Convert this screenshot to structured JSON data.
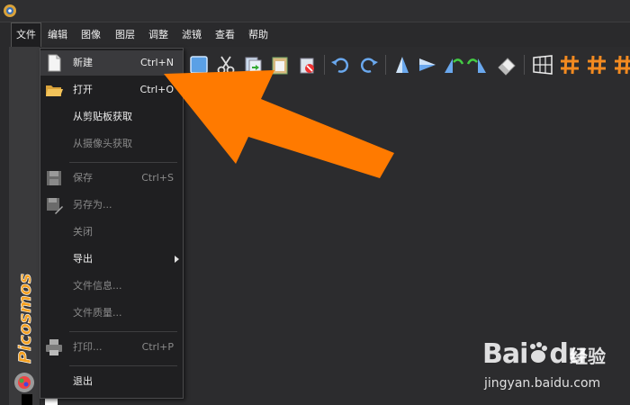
{
  "menubar": {
    "items": [
      "文件",
      "编辑",
      "图像",
      "图层",
      "调整",
      "滤镜",
      "查看",
      "帮助"
    ]
  },
  "file_menu": {
    "items": [
      {
        "label": "新建",
        "shortcut": "Ctrl+N",
        "enabled": true,
        "icon": "new-document-icon"
      },
      {
        "label": "打开",
        "shortcut": "Ctrl+O",
        "enabled": true,
        "icon": "open-folder-icon"
      },
      {
        "label": "从剪贴板获取",
        "shortcut": "",
        "enabled": true
      },
      {
        "label": "从摄像头获取",
        "shortcut": "",
        "enabled": false
      },
      {
        "label": "保存",
        "shortcut": "Ctrl+S",
        "enabled": false,
        "icon": "save-disk-icon"
      },
      {
        "label": "另存为...",
        "shortcut": "",
        "enabled": false,
        "icon": "save-as-icon"
      },
      {
        "label": "关闭",
        "shortcut": "",
        "enabled": false
      },
      {
        "label": "导出",
        "shortcut": "",
        "enabled": true,
        "submenu": true
      },
      {
        "label": "文件信息...",
        "shortcut": "",
        "enabled": false
      },
      {
        "label": "文件质量...",
        "shortcut": "",
        "enabled": false
      },
      {
        "label": "打印...",
        "shortcut": "Ctrl+P",
        "enabled": false,
        "icon": "printer-icon"
      },
      {
        "label": "退出",
        "shortcut": "",
        "enabled": true
      }
    ]
  },
  "sidebar": {
    "brand": "Picosmos"
  },
  "toolbar": {
    "icons": [
      "select-rect-icon",
      "cut-icon",
      "copy-icon",
      "paste-icon",
      "delete-icon",
      "undo-icon",
      "redo-icon",
      "flip-vertical-icon",
      "flip-horizontal-icon",
      "rotate-left-icon",
      "rotate-right-icon",
      "eraser-icon",
      "grid-icon",
      "hash-grid-icon",
      "hash-grid-icon",
      "hash-grid-icon"
    ]
  },
  "watermark": {
    "logo": "Bai",
    "logo_suffix": "du",
    "brand": "经验",
    "url": "jingyan.baidu.com"
  },
  "colors": {
    "accent_arrow": "#ff7a00",
    "menu_bg": "#1f1f21",
    "app_bg": "#2c2c2e"
  }
}
